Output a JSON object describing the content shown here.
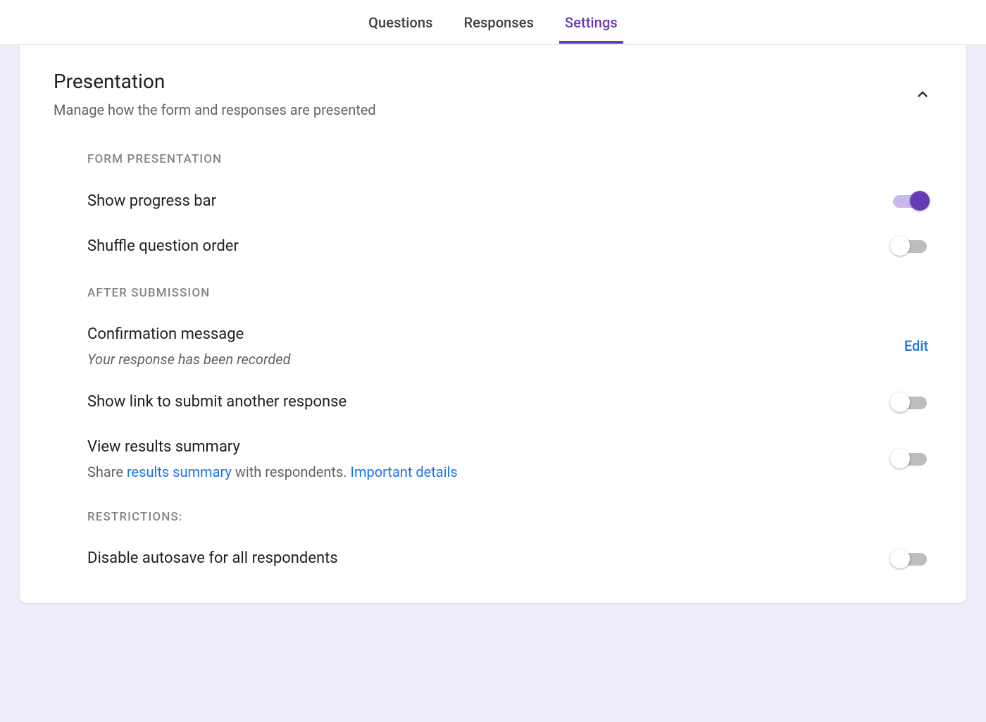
{
  "tabs": {
    "questions": "Questions",
    "responses": "Responses",
    "settings": "Settings"
  },
  "section": {
    "title": "Presentation",
    "subtitle": "Manage how the form and responses are presented"
  },
  "groups": {
    "form_presentation": {
      "label": "FORM PRESENTATION",
      "show_progress_bar": "Show progress bar",
      "shuffle_question_order": "Shuffle question order"
    },
    "after_submission": {
      "label": "AFTER SUBMISSION",
      "confirmation_message": "Confirmation message",
      "confirmation_value": "Your response has been recorded",
      "edit": "Edit",
      "show_link_submit_another": "Show link to submit another response",
      "view_results_summary": "View results summary",
      "share_prefix": "Share ",
      "results_summary_link": "results summary",
      "share_middle": " with respondents. ",
      "important_details": "Important details"
    },
    "restrictions": {
      "label": "RESTRICTIONS:",
      "disable_autosave": "Disable autosave for all respondents"
    }
  }
}
